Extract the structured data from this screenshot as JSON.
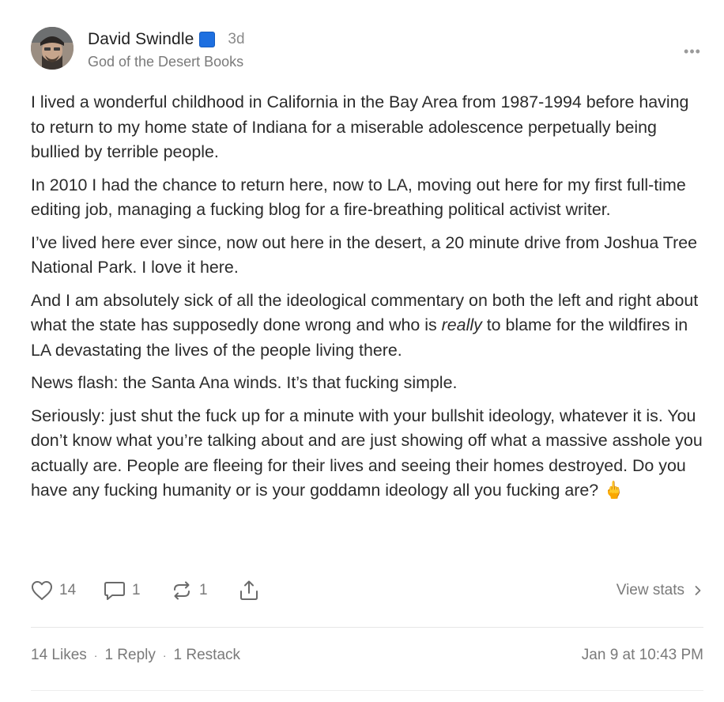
{
  "author": {
    "name": "David Swindle",
    "badge_icon": "blue-square-icon",
    "time_ago": "3d",
    "publication": "God of the Desert Books"
  },
  "more_menu": {
    "icon": "more-dots-icon",
    "glyph": "•••"
  },
  "body": {
    "p1": "I lived a wonderful childhood in California in the Bay Area from 1987-1994 before having to return to my home state of Indiana for a miserable adolescence perpetually being bullied by terrible people.",
    "p2": "In 2010 I had the chance to return here, now to LA, moving out here for my first full-time editing job, managing a fucking blog for a fire-breathing political activist writer.",
    "p3": "I’ve lived here ever since, now out here in the desert, a 20 minute drive from Joshua Tree National Park. I love it here.",
    "p4_before": "And I am absolutely sick of all the ideological commentary on both the left and right about what the state has supposedly done wrong and who is ",
    "p4_emph": "really",
    "p4_after": " to blame for the wildfires in LA devastating the lives of the people living there.",
    "p5": "News flash: the Santa Ana winds. It’s that fucking simple.",
    "p6": "Seriously: just shut the fuck up for a minute with your bullshit ideology, whatever it is. You don’t know what you’re talking about and are just showing off what a massive asshole you actually are. People are fleeing for their lives and seeing their homes destroyed. Do you have any fucking humanity or is your goddamn ideology all you fucking are? ",
    "p6_emoji": "🖕"
  },
  "actions": {
    "like_count": "14",
    "comment_count": "1",
    "restack_count": "1",
    "view_stats": "View stats"
  },
  "footer": {
    "likes": "14 Likes",
    "replies": "1 Reply",
    "restacks": "1 Restack",
    "separator": "·",
    "timestamp": "Jan 9 at 10:43 PM"
  },
  "colors": {
    "text": "#2b2b2b",
    "muted": "#7a7a7a",
    "badge": "#1d6fe0",
    "divider": "#e6e6e6"
  }
}
